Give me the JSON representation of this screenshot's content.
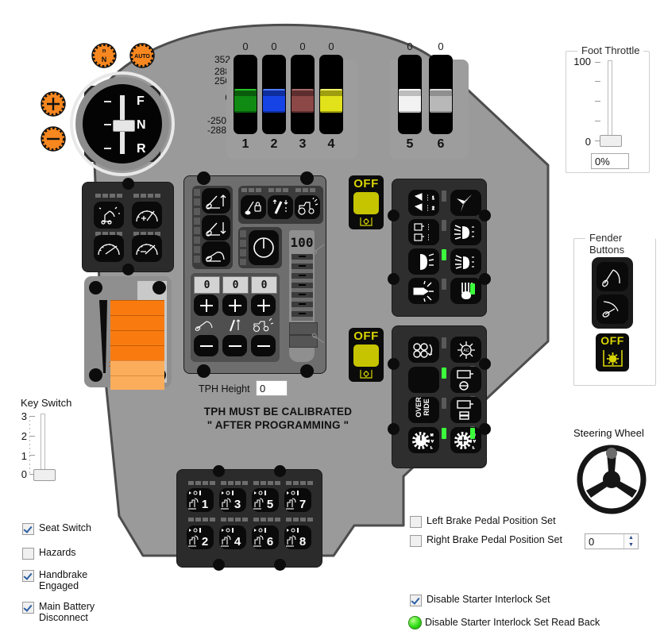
{
  "panel": {
    "body_color": "#9a9a9a",
    "body_outline": "#4d4d4d"
  },
  "transmission": {
    "gear_buttons": [
      {
        "name": "neutral-lock-button",
        "glyph": "N",
        "color": "#f7871f"
      },
      {
        "name": "auto-button",
        "glyph": "AUTO",
        "color": "#f7871f"
      },
      {
        "name": "increase-button",
        "glyph": "+",
        "color": "#f7871f"
      },
      {
        "name": "decrease-button",
        "glyph": "-",
        "color": "#f7871f"
      }
    ],
    "fnr_gauge": {
      "labels": [
        "F",
        "N",
        "R"
      ],
      "selected": "N"
    }
  },
  "spool_sliders": {
    "axis_labels": [
      "352",
      "288",
      "250",
      "0",
      "-250",
      "-288"
    ],
    "group_a": [
      {
        "id": "1",
        "value": "0",
        "color": "#0f8a12"
      },
      {
        "id": "2",
        "value": "0",
        "color": "#1643e6"
      },
      {
        "id": "3",
        "value": "0",
        "color": "#8c4747"
      },
      {
        "id": "4",
        "value": "0",
        "color": "#e2e21b"
      }
    ],
    "group_b": [
      {
        "id": "5",
        "value": "0",
        "color": "#f2f2f2"
      },
      {
        "id": "6",
        "value": "0",
        "color": "#b8b8b8"
      }
    ]
  },
  "left_module": {
    "buttons": [
      {
        "name": "hitch-control-button"
      },
      {
        "name": "gauge-plus-button"
      },
      {
        "name": "gauge-sweep-button"
      },
      {
        "name": "gauge-minus-button"
      }
    ]
  },
  "bar_gauge": {
    "name": "draft-bar-gauge",
    "segments_lit": 7,
    "segments_highlight": 2,
    "color": "#f97b10"
  },
  "center_module": {
    "left_buttons": [
      {
        "name": "hitch-raise-button"
      },
      {
        "name": "hitch-lower-button"
      },
      {
        "name": "hitch-float-button"
      }
    ],
    "top_buttons": [
      {
        "name": "hitch-lock-button"
      },
      {
        "name": "depth-limit-button"
      },
      {
        "name": "tractor-slip-button"
      }
    ],
    "power-button": {
      "name": "power-button"
    },
    "slider": {
      "name": "hitch-depth-slider",
      "value": "100"
    },
    "steppers": [
      {
        "name": "stepper-hitch",
        "value": "0"
      },
      {
        "name": "stepper-depth",
        "value": "0"
      },
      {
        "name": "stepper-slip",
        "value": "0"
      },
      {
        "plus": "+",
        "minus": "—"
      }
    ],
    "plus_glyph": "+",
    "minus_glyph": "—"
  },
  "tph": {
    "label": "TPH Height",
    "value": "0",
    "warning_line1": "TPH MUST BE CALIBRATED",
    "warning_line2": "\" AFTER PROGRAMMING \""
  },
  "off_buttons": [
    {
      "name": "work-light-off-button-upper",
      "label": "OFF"
    },
    {
      "name": "work-light-off-button-lower",
      "label": "OFF"
    }
  ],
  "right_module_top": {
    "buttons": [
      {
        "name": "beacon-button"
      },
      {
        "name": "auto-wiper-button",
        "glyph": "AUTO"
      },
      {
        "name": "cab-light-button"
      },
      {
        "name": "work-light-front-button"
      },
      {
        "name": "headlight-dip-button"
      },
      {
        "name": "work-light-rear-button"
      },
      {
        "name": "hazard-light-button"
      },
      {
        "name": "rear-wiper-button"
      }
    ],
    "leds_on": [
      4,
      7
    ]
  },
  "right_module_bottom": {
    "buttons": [
      {
        "name": "fan-reverse-button"
      },
      {
        "name": "air-conditioning-button"
      },
      {
        "name": "blank-button"
      },
      {
        "name": "pto-rear-button"
      },
      {
        "name": "override-button",
        "glyph_line1": "OVER",
        "glyph_line2": "RIDE"
      },
      {
        "name": "pto-front-button"
      },
      {
        "name": "diff-lock-button"
      },
      {
        "name": "four-wheel-drive-button"
      }
    ],
    "leds_on": [
      1,
      3,
      6,
      7
    ]
  },
  "seat_keypad": {
    "buttons": [
      {
        "name": "memory-button-1",
        "label": "1"
      },
      {
        "name": "memory-button-3",
        "label": "3"
      },
      {
        "name": "memory-button-5",
        "label": "5"
      },
      {
        "name": "memory-button-7",
        "label": "7"
      },
      {
        "name": "memory-button-2",
        "label": "2"
      },
      {
        "name": "memory-button-4",
        "label": "4"
      },
      {
        "name": "memory-button-6",
        "label": "6"
      },
      {
        "name": "memory-button-8",
        "label": "8"
      }
    ]
  },
  "foot_throttle": {
    "title": "Foot Throttle",
    "max_label": "100",
    "min_label": "0",
    "value": "0%"
  },
  "fender_buttons": {
    "title": "Fender Buttons",
    "buttons": [
      {
        "name": "fender-hitch-raise-button"
      },
      {
        "name": "fender-hitch-lower-button"
      }
    ],
    "off_button": {
      "name": "fender-work-light-off-button",
      "label": "OFF"
    }
  },
  "steering_wheel": {
    "title": "Steering Wheel",
    "value": "0"
  },
  "key_switch": {
    "title": "Key Switch",
    "ticks": [
      "3",
      "2",
      "1",
      "0"
    ],
    "value": 0
  },
  "left_checkboxes": [
    {
      "name": "seat-switch-checkbox",
      "label": "Seat Switch",
      "checked": true
    },
    {
      "name": "hazards-checkbox",
      "label": "Hazards",
      "checked": false
    },
    {
      "name": "handbrake-engaged-checkbox",
      "label": "Handbrake\nEngaged",
      "checked": true
    },
    {
      "name": "main-battery-disconnect-checkbox",
      "label": "Main Battery\nDisconnect",
      "checked": true
    }
  ],
  "right_checkboxes": [
    {
      "name": "left-brake-pedal-position-set-checkbox",
      "label": "Left Brake Pedal Position Set",
      "checked": false
    },
    {
      "name": "right-brake-pedal-position-set-checkbox",
      "label": "Right Brake Pedal Position Set",
      "checked": false
    }
  ],
  "starter_interlock": {
    "set_label": "Disable Starter Interlock Set",
    "set_checked": true,
    "readback_label": "Disable Starter Interlock Set Read Back",
    "readback_color": "#33dd18"
  }
}
